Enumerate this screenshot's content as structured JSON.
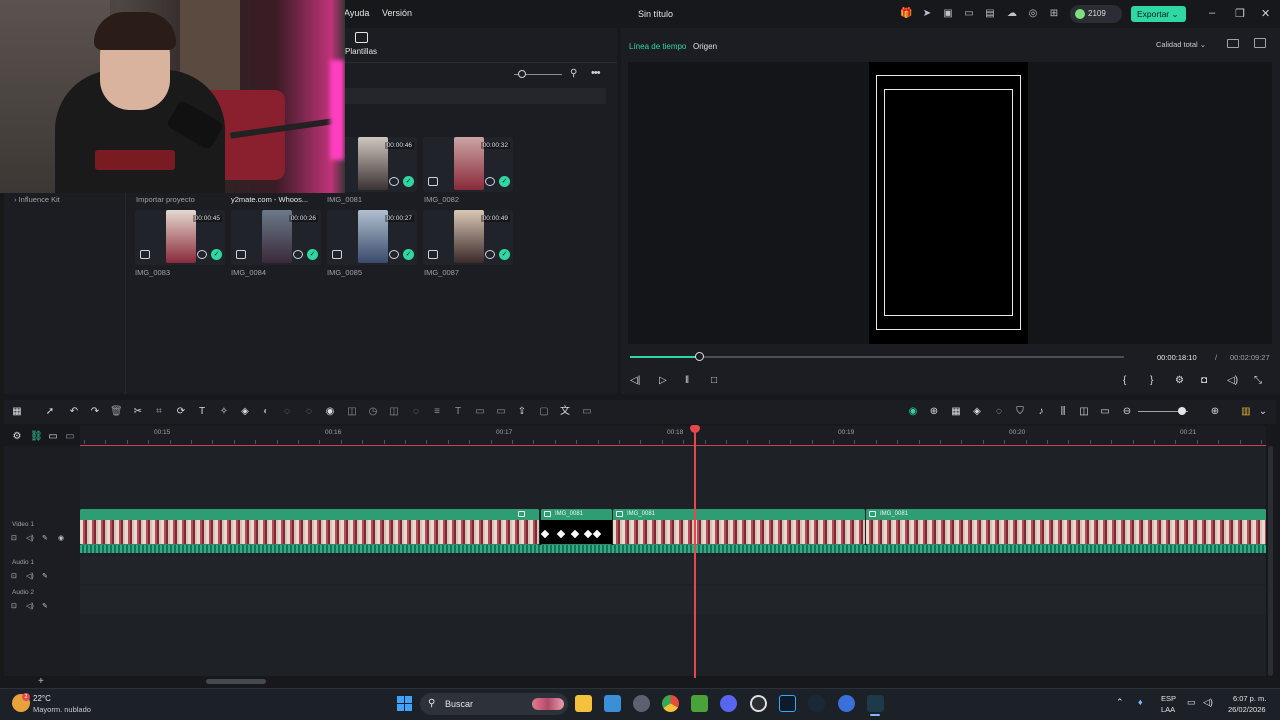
{
  "titlebar": {
    "menus": [
      "Ayuda",
      "Versión"
    ],
    "title": "Sin título",
    "credits": "2109",
    "export_label": "Exportar",
    "colors": {
      "accent": "#2fd8a3"
    }
  },
  "media": {
    "tab_label": "Plantillas",
    "left_nav_item": "Influence Kit",
    "import_label": "Importar proyecto",
    "folder_label": "y2mate.com - Whoos...",
    "clips": [
      {
        "name": "IMG_0081",
        "duration": "00:00:46"
      },
      {
        "name": "IMG_0082",
        "duration": "00:00:32"
      },
      {
        "name": "IMG_0083",
        "duration": "00:00:45"
      },
      {
        "name": "IMG_0084",
        "duration": "00:00:26"
      },
      {
        "name": "IMG_0085",
        "duration": "00:00:27"
      },
      {
        "name": "IMG_0087",
        "duration": "00:00:49"
      }
    ]
  },
  "preview": {
    "tabs": [
      "Línea de tiempo",
      "Origen"
    ],
    "quality": "Calidad total",
    "current_time": "00:00:18:10",
    "separator": "/",
    "total_time": "00:02:09:27",
    "progress": 0.14
  },
  "timeline": {
    "ruler_labels": [
      "00:15",
      "00:16",
      "00:17",
      "00:18",
      "00:19",
      "00:20",
      "00:21"
    ],
    "tracks": {
      "video1": "Video 1",
      "audio1": "Audio 1",
      "audio2": "Audio 2"
    },
    "clip_label": "IMG_0081"
  },
  "taskbar": {
    "temperature": "22°C",
    "weather": "Mayorm. nublado",
    "weather_badge": "2",
    "search_placeholder": "Buscar",
    "lang_top": "ESP",
    "lang_bottom": "LAA",
    "time": "6:07 p. m.",
    "date": "26/02/2026"
  }
}
